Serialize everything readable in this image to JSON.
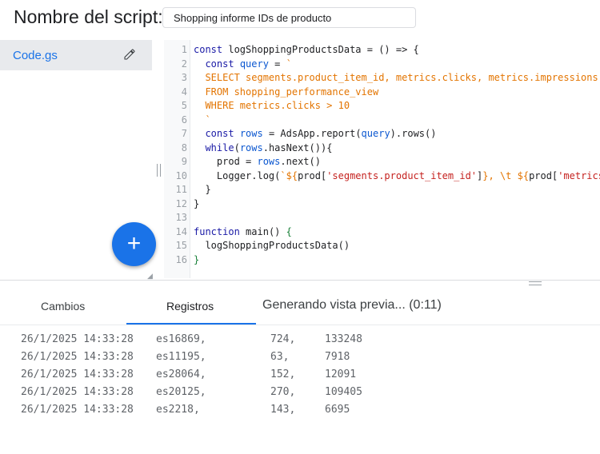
{
  "header": {
    "label": "Nombre del script:",
    "script_name": "Shopping informe IDs de producto"
  },
  "sidebar": {
    "file_name": "Code.gs",
    "fab_label": "+"
  },
  "editor": {
    "lines": [
      {
        "n": "1",
        "text": "const logShoppingProductsData = () => {"
      },
      {
        "n": "2",
        "text": "  const query = `"
      },
      {
        "n": "3",
        "text": "  SELECT segments.product_item_id, metrics.clicks, metrics.impressions"
      },
      {
        "n": "4",
        "text": "  FROM shopping_performance_view"
      },
      {
        "n": "5",
        "text": "  WHERE metrics.clicks > 10"
      },
      {
        "n": "6",
        "text": "  `"
      },
      {
        "n": "7",
        "text": "  const rows = AdsApp.report(query).rows()"
      },
      {
        "n": "8",
        "text": "  while(rows.hasNext()){"
      },
      {
        "n": "9",
        "text": "    prod = rows.next()"
      },
      {
        "n": "10",
        "text": "    Logger.log(`${prod['segments.product_item_id']}, \\t ${prod['metrics"
      },
      {
        "n": "11",
        "text": "  }"
      },
      {
        "n": "12",
        "text": "}"
      },
      {
        "n": "13",
        "text": ""
      },
      {
        "n": "14",
        "text": "function main() {"
      },
      {
        "n": "15",
        "text": "  logShoppingProductsData()"
      },
      {
        "n": "16",
        "text": "}"
      }
    ]
  },
  "tabs": {
    "changes": "Cambios",
    "logs": "Registros",
    "status": "Generando vista previa... (0:11)"
  },
  "logs": [
    {
      "time": "26/1/2025 14:33:28",
      "id": "es16869,",
      "clicks": "724,",
      "impressions": "133248"
    },
    {
      "time": "26/1/2025 14:33:28",
      "id": "es11195,",
      "clicks": "63,",
      "impressions": "7918"
    },
    {
      "time": "26/1/2025 14:33:28",
      "id": "es28064,",
      "clicks": "152,",
      "impressions": "12091"
    },
    {
      "time": "26/1/2025 14:33:28",
      "id": "es20125,",
      "clicks": "270,",
      "impressions": "109405"
    },
    {
      "time": "26/1/2025 14:33:28",
      "id": "es2218,",
      "clicks": "143,",
      "impressions": "6695"
    }
  ]
}
